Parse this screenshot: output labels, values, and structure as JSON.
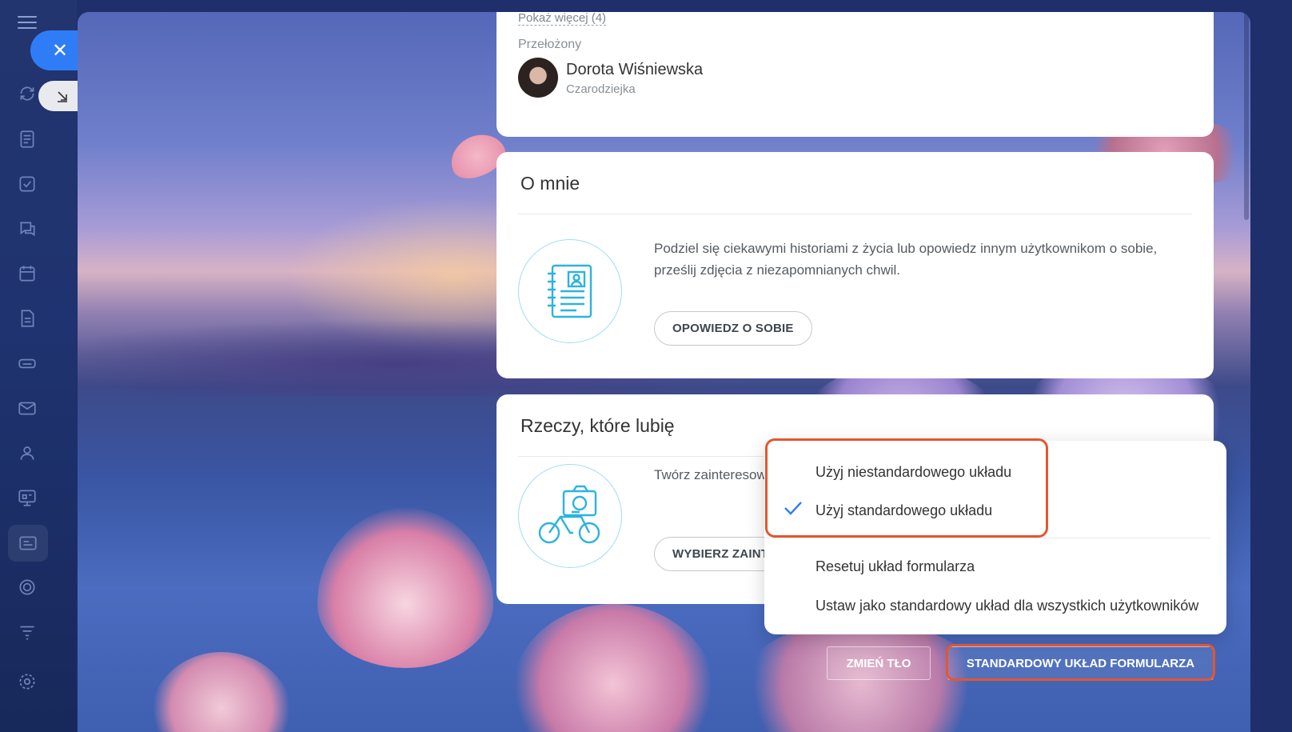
{
  "sidebar": {
    "icons": [
      "menu-icon",
      "sync-icon",
      "feed-icon",
      "tasks-icon",
      "chat-icon",
      "calendar-icon",
      "document-icon",
      "drive-icon",
      "mail-icon",
      "contacts-icon",
      "contact-center-icon",
      "crm-icon",
      "target-icon",
      "filter-icon",
      "settings-icon"
    ]
  },
  "profile": {
    "show_more": "Pokaż więcej (4)",
    "supervisor_label": "Przełożony",
    "supervisor_name": "Dorota Wiśniewska",
    "supervisor_role": "Czarodziejka"
  },
  "about": {
    "title": "O mnie",
    "description": "Podziel się ciekawymi historiami z życia lub opowiedz innym użytkownikom o sobie, prześlij zdjęcia z niezapomnianych chwil.",
    "button": "OPOWIEDZ O SOBIE"
  },
  "interests": {
    "title": "Rzeczy, które lubię",
    "description": "Twórz zainteresowania i dołącz do grup, które podzielają twoje zainteresowania.",
    "button": "WYBIERZ ZAINTERESOWANIA"
  },
  "menu": {
    "items": [
      {
        "label": "Użyj niestandardowego układu",
        "checked": false
      },
      {
        "label": "Użyj standardowego układu",
        "checked": true
      },
      {
        "label": "Resetuj układ formularza",
        "checked": false
      },
      {
        "label": "Ustaw jako standardowy układ dla wszystkich użytkowników",
        "checked": false
      }
    ]
  },
  "bottom": {
    "change_bg": "ZMIEŃ TŁO",
    "layout": "STANDARDOWY UKŁAD FORMULARZA"
  },
  "colors": {
    "accent": "#2f7df6",
    "highlight": "#e4562f",
    "illustration": "#2bb3e0"
  }
}
